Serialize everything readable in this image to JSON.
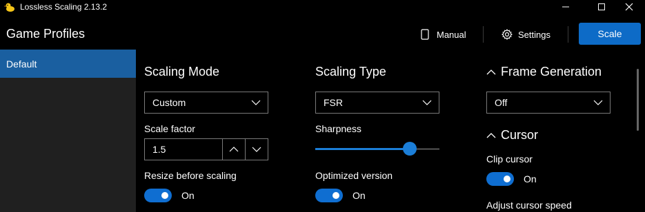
{
  "window": {
    "title": "Lossless Scaling 2.13.2",
    "icon": "duck-icon",
    "minimize": "—",
    "maximize": "☐",
    "close": "✕"
  },
  "header": {
    "title": "Game Profiles",
    "manual_label": "Manual",
    "settings_label": "Settings",
    "scale_label": "Scale"
  },
  "sidebar": {
    "items": [
      {
        "label": "Default",
        "selected": true
      }
    ]
  },
  "scaling_mode": {
    "title": "Scaling Mode",
    "mode_value": "Custom",
    "scale_factor_label": "Scale factor",
    "scale_factor_value": "1.5",
    "resize_label": "Resize before scaling",
    "resize_state": "On"
  },
  "scaling_type": {
    "title": "Scaling Type",
    "type_value": "FSR",
    "sharpness_label": "Sharpness",
    "sharpness_level": 0.76,
    "optimized_label": "Optimized version",
    "optimized_state": "On"
  },
  "frame_generation": {
    "title": "Frame Generation",
    "value": "Off"
  },
  "cursor": {
    "title": "Cursor",
    "clip_label": "Clip cursor",
    "clip_state": "On",
    "speed_label": "Adjust cursor speed"
  },
  "colors": {
    "accent": "#0d6bc7",
    "selected_item": "#1a5fa0",
    "sidebar_bg": "#202020",
    "background": "#000000"
  }
}
